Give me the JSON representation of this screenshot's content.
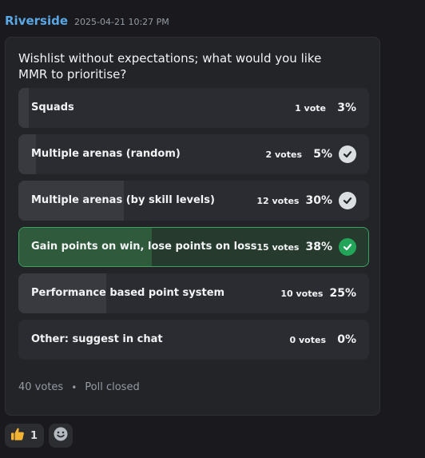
{
  "message": {
    "author": "Riverside",
    "timestamp": "2025-04-21 10:27 PM"
  },
  "poll": {
    "question": "Wishlist without expectations; what would you like MMR to prioritise?",
    "answers": [
      {
        "label": "Squads",
        "votes": "1 vote",
        "percent": "3%",
        "fraction": 0.03,
        "checked": false,
        "selected": false
      },
      {
        "label": "Multiple arenas (random)",
        "votes": "2 votes",
        "percent": "5%",
        "fraction": 0.05,
        "checked": true,
        "selected": false
      },
      {
        "label": "Multiple arenas (by skill levels)",
        "votes": "12 votes",
        "percent": "30%",
        "fraction": 0.3,
        "checked": true,
        "selected": false
      },
      {
        "label": "Gain points on win, lose points on loss",
        "votes": "15 votes",
        "percent": "38%",
        "fraction": 0.38,
        "checked": true,
        "selected": true
      },
      {
        "label": "Performance based point system",
        "votes": "10 votes",
        "percent": "25%",
        "fraction": 0.25,
        "checked": false,
        "selected": false
      },
      {
        "label": "Other: suggest in chat",
        "votes": "0 votes",
        "percent": "0%",
        "fraction": 0.0,
        "checked": false,
        "selected": false
      }
    ],
    "total_votes": "40 votes",
    "status": "Poll closed"
  },
  "reactions": [
    {
      "icon": "thumbs-up-icon",
      "count": "1"
    }
  ],
  "colors": {
    "author": "#5aa7e6",
    "winner_border": "#3aa35f",
    "check_green": "#23a559"
  }
}
